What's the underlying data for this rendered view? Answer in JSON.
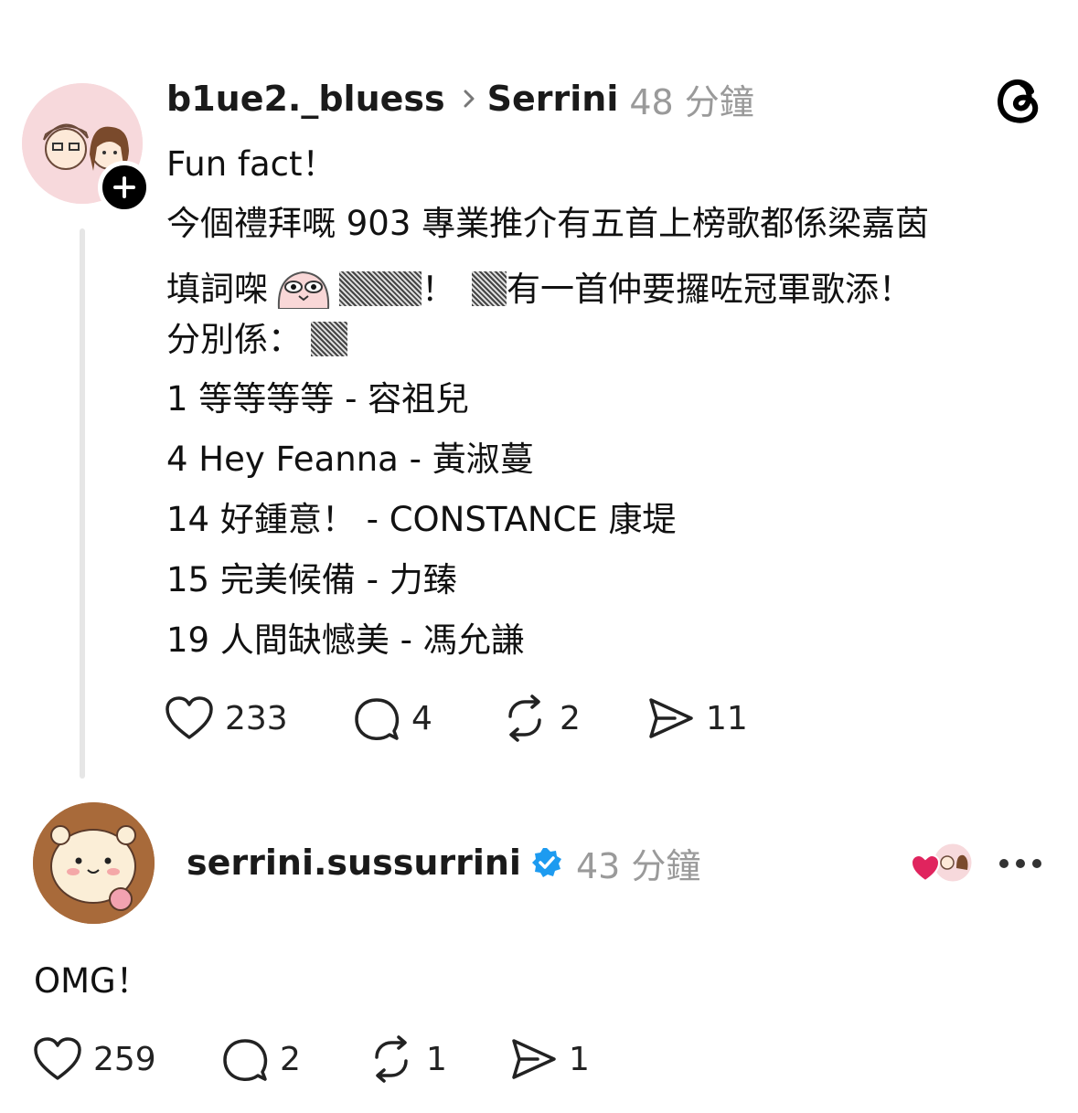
{
  "post": {
    "author": "b1ue2._bluess",
    "reply_target": "Serrini",
    "time": "48 分鐘",
    "lines": {
      "l1": "Fun fact！",
      "l2": "今個禮拜嘅 903 專業推介有五首上榜歌都係梁嘉茵",
      "l3a": "填詞㗎",
      "l3b": "！",
      "l3c": "有一首仲要攞咗冠軍歌添！",
      "l4": "分別係：",
      "s1": "1 等等等等 - 容祖兒",
      "s2": "4 Hey Feanna - 黃淑蔓",
      "s3": "14 好鍾意！ - CONSTANCE 康堤",
      "s4": "15 完美候備 - 力臻",
      "s5": "19 人間缺憾美 - 馮允謙"
    },
    "stats": {
      "likes": "233",
      "comments": "4",
      "reposts": "2",
      "shares": "11"
    }
  },
  "reply": {
    "author": "serrini.sussurrini",
    "time": "43 分鐘",
    "text": "OMG！",
    "stats": {
      "likes": "259",
      "comments": "2",
      "reposts": "1",
      "shares": "1"
    }
  },
  "colors": {
    "verified": "#1d9bf0",
    "heart": "#e0245e",
    "muted": "#9a9a9a"
  },
  "icons": [
    "threads-logo-icon",
    "heart-icon",
    "comment-icon",
    "repost-icon",
    "share-icon",
    "verified-icon",
    "more-icon",
    "chevron-right-icon",
    "plus-icon"
  ]
}
